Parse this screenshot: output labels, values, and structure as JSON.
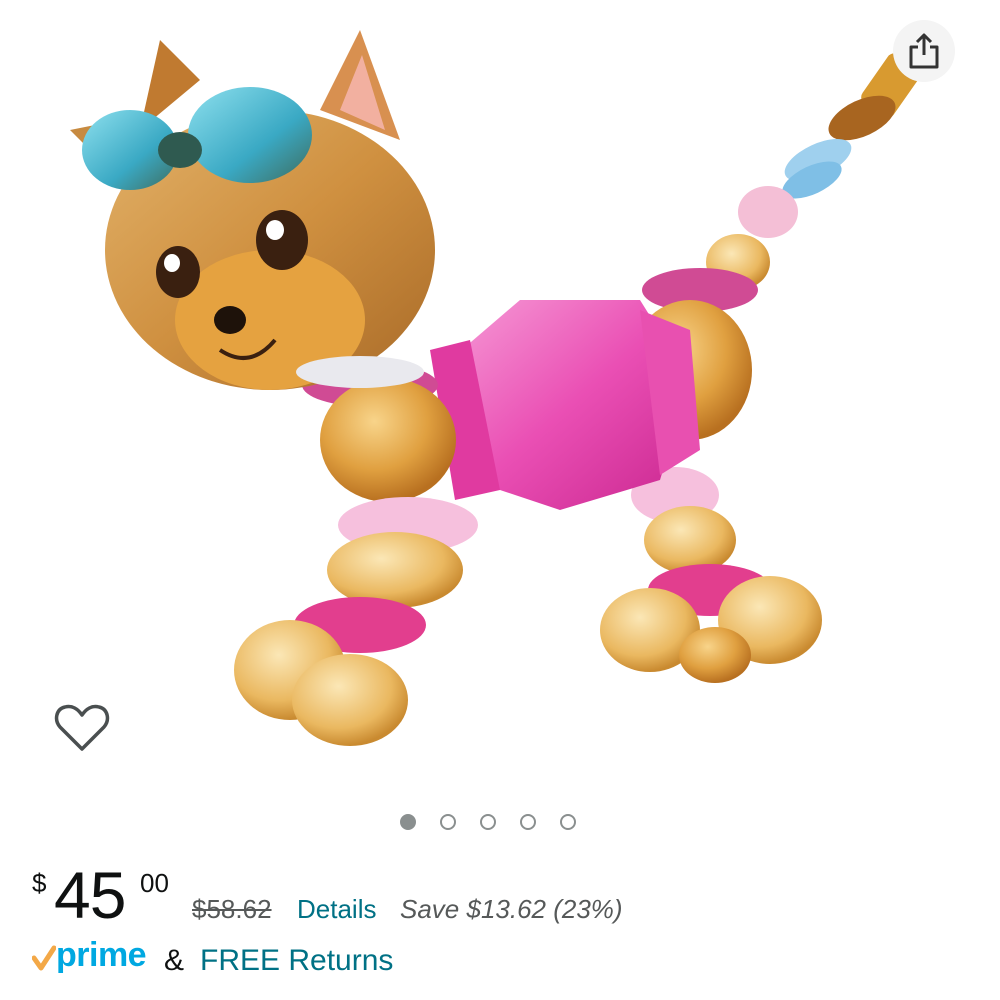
{
  "product": {
    "image_description_icon": "product-photo",
    "share_icon": "share-icon",
    "wishlist_icon": "heart-icon"
  },
  "carousel": {
    "count": 5,
    "active_index": 0
  },
  "price": {
    "currency_symbol": "$",
    "whole": "45",
    "fraction": "00",
    "list_price": "$58.62",
    "details_label": "Details",
    "savings": "Save $13.62 (23%)"
  },
  "shipping": {
    "prime_label": "prime",
    "ampersand": "&",
    "returns_label": "FREE Returns"
  },
  "colors": {
    "link": "#007185",
    "prime_blue": "#00a8e1",
    "prime_check": "#f3a847",
    "text": "#0f1111",
    "muted": "#565959"
  }
}
